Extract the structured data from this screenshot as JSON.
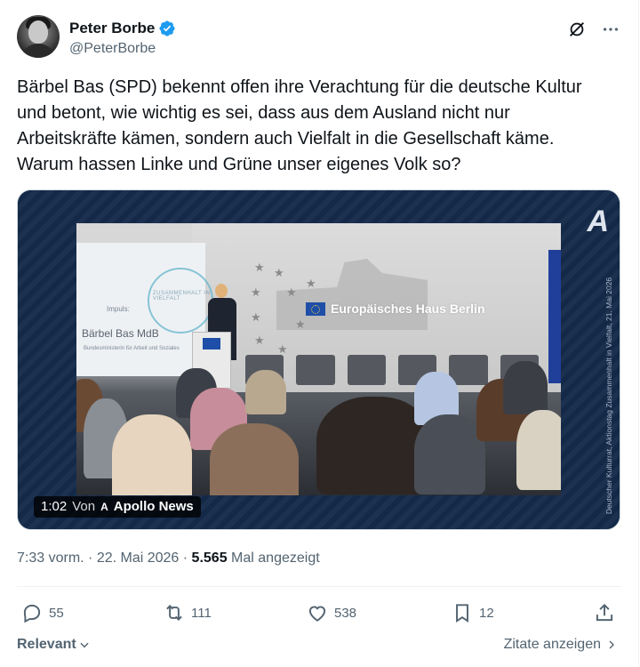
{
  "author": {
    "name": "Peter Borbe",
    "handle": "@PeterBorbe",
    "verified": true
  },
  "tweet": {
    "text": "Bärbel Bas (SPD) bekennt offen ihre Verachtung für die deutsche Kultur\nund betont, wie wichtig es sei, dass aus dem Ausland nicht nur\nArbeitskräfte kämen, sondern auch Vielfalt in die Gesellschaft käme.\nWarum hassen Linke und Grüne unser eigenes Volk so?"
  },
  "media": {
    "duration": "1:02",
    "from_label": "Von",
    "source_logo": "A",
    "source_name": "Apollo News",
    "watermark": "A",
    "side_caption": "Deutscher Kulturrat, Aktionstag Zusammenhalt in Vielfalt, 21. Mai 2026",
    "sign_text": "Europäisches Haus Berlin",
    "screen_label": "Impuls:",
    "screen_name": "Bärbel Bas MdB",
    "screen_sub": "Bundesministerin für Arbeit und Soziales",
    "screen_logo": "ZUSAMMENHALT IN VIELFALT"
  },
  "meta": {
    "time": "7:33 vorm.",
    "sep1": " · ",
    "date": "22. Mai 2026",
    "sep2": " · ",
    "views": "5.565",
    "views_label": " Mal angezeigt"
  },
  "actions": {
    "replies": "55",
    "reposts": "111",
    "likes": "538",
    "bookmarks": "12"
  },
  "footer": {
    "sort_label": "Relevant",
    "quotes_label": "Zitate anzeigen"
  },
  "icons": {
    "grok": "grok-icon",
    "more": "more-icon",
    "reply": "reply-icon",
    "repost": "repost-icon",
    "like": "like-icon",
    "bookmark": "bookmark-icon",
    "share": "share-icon"
  },
  "colors": {
    "verified": "#1d9bf0",
    "text": "#0f1419",
    "secondary": "#536471"
  }
}
